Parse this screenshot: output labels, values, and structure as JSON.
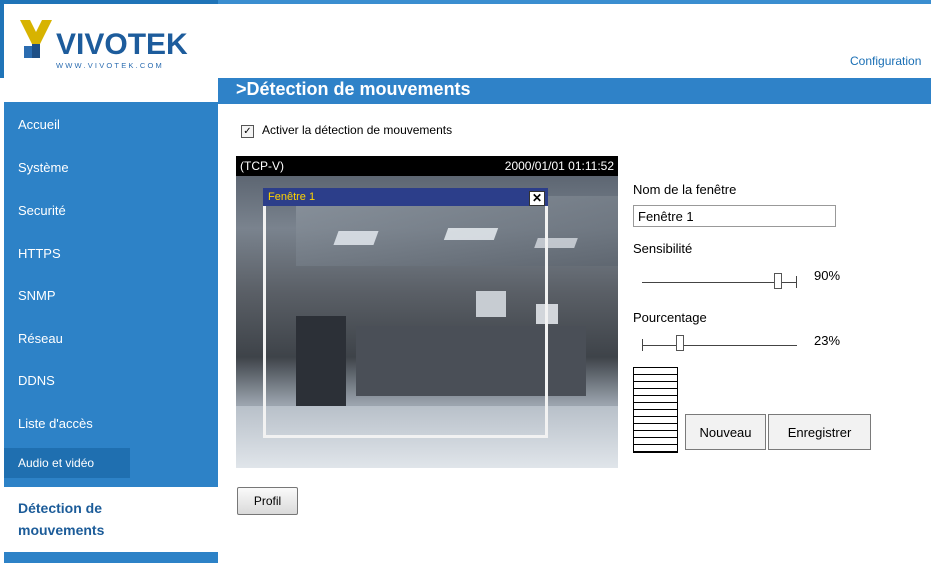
{
  "header": {
    "brand": "VIVOTEK",
    "brand_url": "WWW.VIVOTEK.COM",
    "config_link": "Configuration",
    "page_title": ">Détection de mouvements"
  },
  "sidebar": {
    "items": [
      {
        "label": "Accueil"
      },
      {
        "label": "Système"
      },
      {
        "label": "Securité"
      },
      {
        "label": "HTTPS"
      },
      {
        "label": "SNMP"
      },
      {
        "label": "Réseau"
      },
      {
        "label": "DDNS"
      },
      {
        "label": "Liste d'accès"
      },
      {
        "label": "Audio et vidéo"
      }
    ],
    "active_label": "Détection de mouvements"
  },
  "main": {
    "enable_checkbox": {
      "label": "Activer la détection de mouvements",
      "checked": true
    },
    "video": {
      "stream_label": "(TCP-V)",
      "timestamp": "2000/01/01 01:11:52",
      "motion_window_name": "Fenêtre 1",
      "close_glyph": "✕"
    },
    "window_name": {
      "label": "Nom de la fenêtre",
      "value": "Fenêtre 1"
    },
    "sensitivity": {
      "label": "Sensibilité",
      "value": 90,
      "display": "90%"
    },
    "percentage": {
      "label": "Pourcentage",
      "value": 23,
      "display": "23%"
    },
    "buttons": {
      "new": "Nouveau",
      "save": "Enregistrer",
      "profile": "Profil"
    }
  },
  "colors": {
    "accent": "#2d82c7",
    "title_bar": "#2f82c8",
    "link": "#1a6fb5"
  }
}
